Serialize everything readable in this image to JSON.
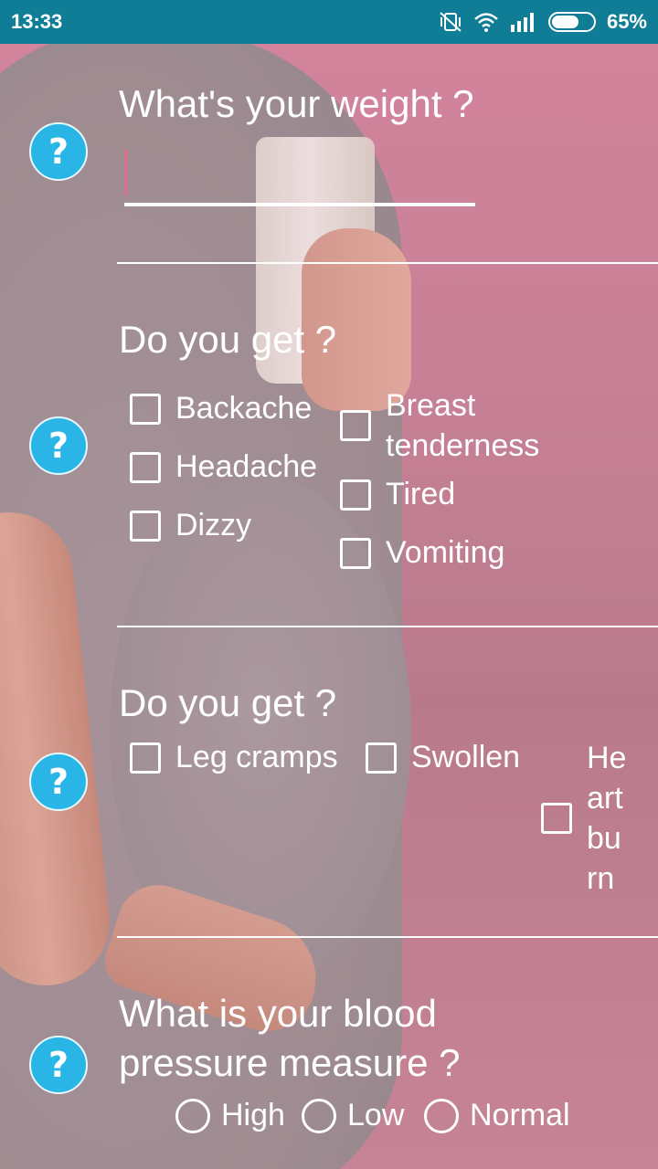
{
  "status_bar": {
    "time": "13:33",
    "battery_percent": "65%",
    "battery_level": 0.65,
    "icons": [
      "vibrate-off-icon",
      "wifi-icon",
      "signal-icon",
      "battery-icon"
    ]
  },
  "accent_colors": {
    "status_bar": "#0f7d96",
    "help_icon": "#29b6e6",
    "caret": "#e46c8d"
  },
  "help_icon_glyph": "?",
  "weight_section": {
    "question": "What's your weight ?",
    "value": "",
    "placeholder": ""
  },
  "symptoms_section_1": {
    "question": "Do you get ?",
    "options": [
      "Backache",
      "Headache",
      "Dizzy",
      "Breast tenderness",
      "Tired",
      "Vomiting"
    ]
  },
  "symptoms_section_2": {
    "question": "Do you get ?",
    "options": [
      "Leg cramps",
      "Swollen",
      "Heartburn"
    ],
    "heartburn_wrapped_lines": [
      "He",
      "art",
      "bu",
      "rn"
    ]
  },
  "blood_pressure_section": {
    "question_lines": [
      "What is your blood",
      "pressure measure ?"
    ],
    "options": [
      "High",
      "Low",
      "Normal"
    ]
  }
}
